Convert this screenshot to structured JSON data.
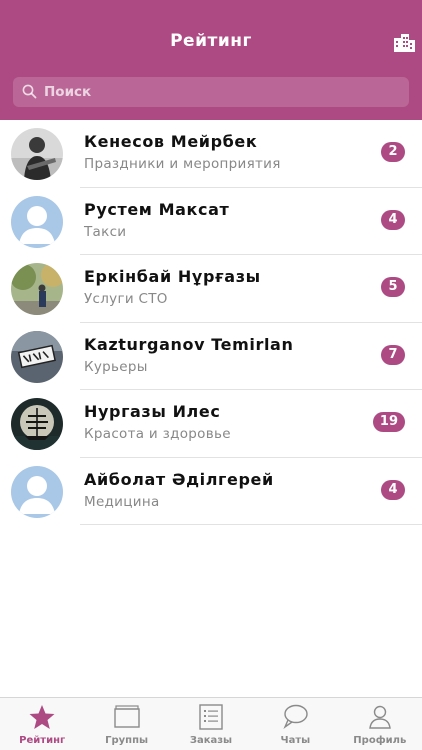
{
  "header": {
    "title": "Рейтинг",
    "city_icon": "city-buildings-icon"
  },
  "search": {
    "placeholder": "Поиск"
  },
  "rows": [
    {
      "name": "Кенесов Мейрбек",
      "category": "Праздники и мероприятия",
      "count": "2",
      "avatar": "photo-guitar"
    },
    {
      "name": "Рустем Максат",
      "category": "Такси",
      "count": "4",
      "avatar": "default"
    },
    {
      "name": "Еркінбай Нұрғазы",
      "category": "Услуги СТО",
      "count": "5",
      "avatar": "photo-outdoor"
    },
    {
      "name": "Kazturganov Temirlan",
      "category": "Курьеры",
      "count": "7",
      "avatar": "photo-sign"
    },
    {
      "name": "Нургазы Илес",
      "category": "Красота и здоровье",
      "count": "19",
      "avatar": "photo-ship"
    },
    {
      "name": "Айболат Әділгерей",
      "category": "Медицина",
      "count": "4",
      "avatar": "default"
    }
  ],
  "tabs": [
    {
      "label": "Рейтинг",
      "icon": "star-icon",
      "active": true
    },
    {
      "label": "Группы",
      "icon": "folders-icon",
      "active": false
    },
    {
      "label": "Заказы",
      "icon": "list-icon",
      "active": false
    },
    {
      "label": "Чаты",
      "icon": "chat-bubbles-icon",
      "active": false
    },
    {
      "label": "Профиль",
      "icon": "person-icon",
      "active": false
    }
  ],
  "colors": {
    "accent": "#ad4a83",
    "avatar_default": "#a9c7e6"
  }
}
